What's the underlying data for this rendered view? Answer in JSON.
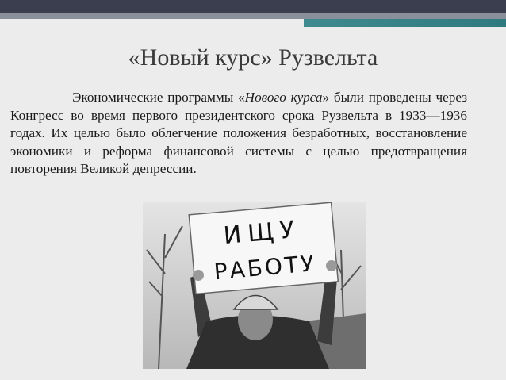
{
  "slide": {
    "title": "«Новый курс» Рузвельта",
    "paragraph": {
      "part1": "Экономические программы «",
      "italic": "Нового курса",
      "part2": "» были проведены через Конгресс во время первого президентского срока Рузвельта в 1933—1936 годах. Их целью было облегчение положения безработных, восстановление экономики и реформа финансовой системы с целью предотвращения повторения Великой депрессии."
    },
    "photo": {
      "sign_line1": "ИЩУ",
      "sign_line2": "РАБОТУ"
    }
  },
  "colors": {
    "header_dark": "#3a3e4e",
    "header_light": "#8a8f9c",
    "accent_teal": "#3f8a8e",
    "background": "#ececec"
  }
}
